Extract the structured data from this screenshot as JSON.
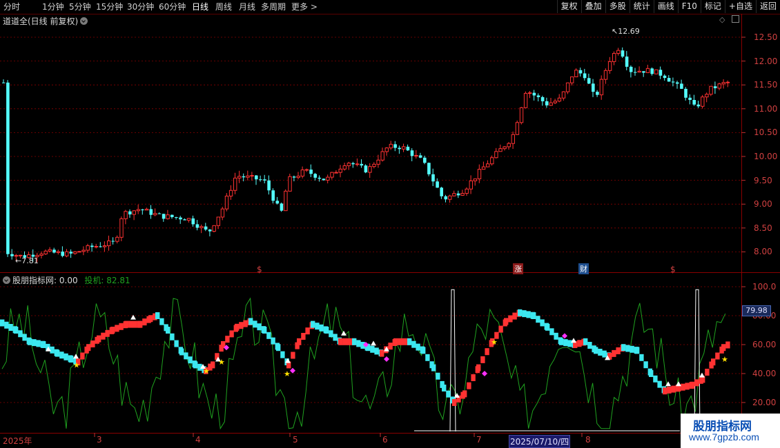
{
  "toolbar": {
    "periods": [
      "分时",
      "1分钟",
      "5分钟",
      "15分钟",
      "30分钟",
      "60分钟",
      "日线",
      "周线",
      "月线",
      "多周期",
      "更多 >"
    ],
    "active_period": "日线",
    "right_buttons": [
      "复权",
      "叠加",
      "多股",
      "统计",
      "画线",
      "F10",
      "标记",
      "+自选",
      "返回"
    ]
  },
  "main_panel": {
    "title": "道道全(日线 前复权)",
    "high_label": "12.69",
    "low_label": "7.81",
    "y_ticks": [
      "12.50",
      "12.00",
      "11.50",
      "11.00",
      "10.50",
      "10.00",
      "9.50",
      "9.00",
      "8.50",
      "8.00"
    ],
    "event_markers": [
      "$",
      "涨",
      "财",
      "$"
    ]
  },
  "indicator_panel": {
    "name": "股朋指标网",
    "value": ": 0.00",
    "series_label": "投机: 82.81",
    "y_ticks": [
      "100.0",
      "80.00",
      "60.00",
      "40.00",
      "20.00"
    ],
    "current_value": "79.98"
  },
  "date_axis": {
    "labels": [
      "2025年",
      "3",
      "4",
      "5",
      "6",
      "7",
      "2025/07/10/四",
      "8"
    ]
  },
  "watermark": {
    "line1": "股朋指标网",
    "line2": "www.7gpzb.com"
  },
  "colors": {
    "up": "#ff3232",
    "down": "#54ffff",
    "grid": "#8b0000",
    "spec_line": "#1fa21f"
  }
}
